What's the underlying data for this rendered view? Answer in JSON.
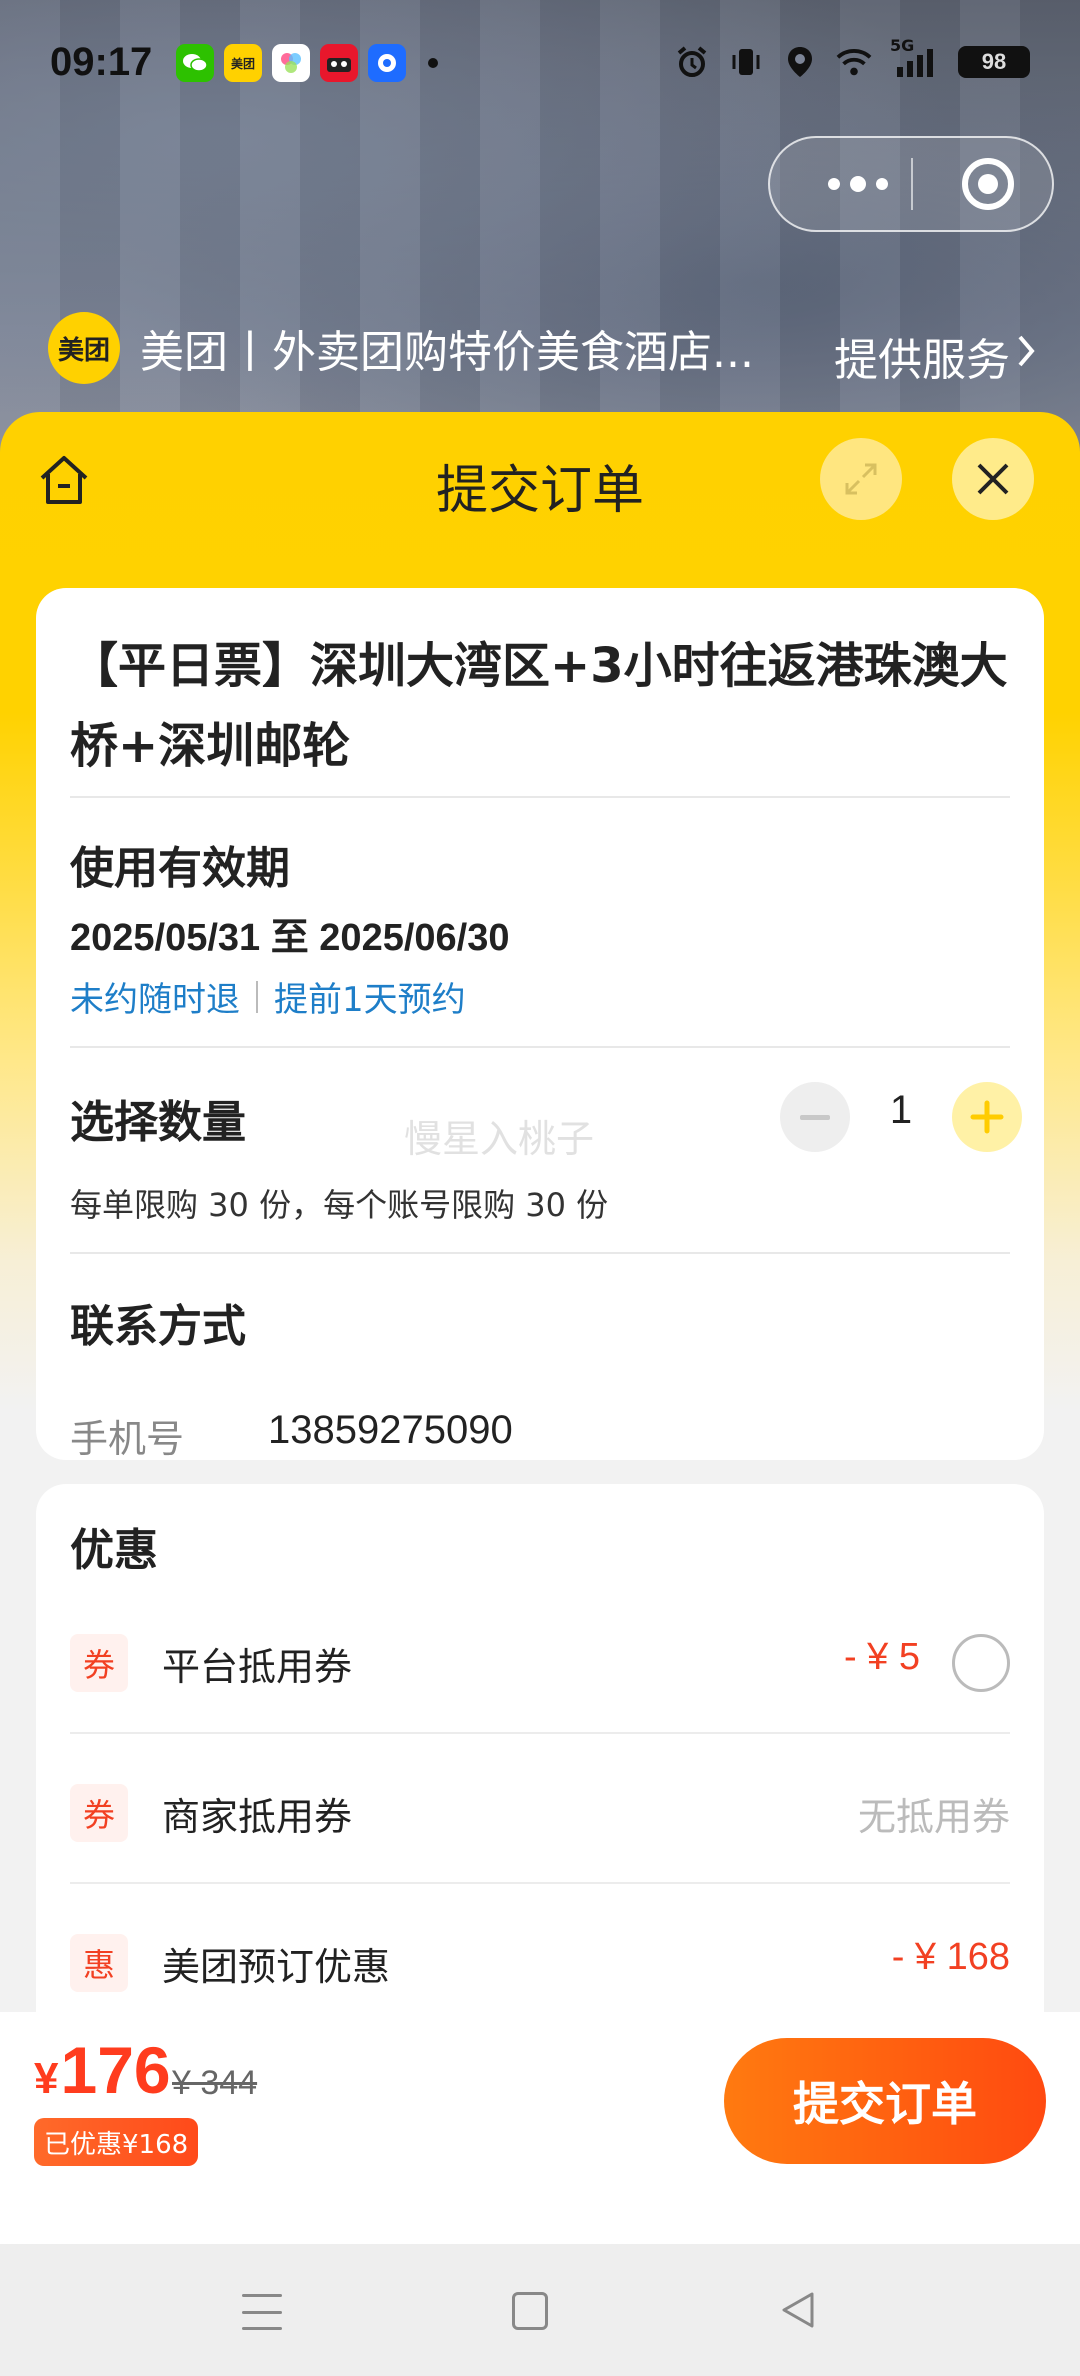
{
  "status_bar": {
    "time": "09:17",
    "battery": "98",
    "network": "5G",
    "app_icons": [
      "wechat-icon",
      "meituan-app-icon",
      "photos-app-icon",
      "tmall-app-icon",
      "browser-app-icon"
    ],
    "right_icons": [
      "alarm-icon",
      "vibrate-icon",
      "location-icon",
      "wifi-icon",
      "signal-icon",
      "battery-icon"
    ]
  },
  "capsule": {
    "more": "more-icon",
    "close": "target-icon"
  },
  "mini_program": {
    "logo_text": "美团",
    "name": "美团丨外卖团购特价美食酒店...",
    "service": "提供服务"
  },
  "sheet": {
    "title": "提交订单"
  },
  "order": {
    "product_title": "【平日票】深圳大湾区+3小时往返港珠澳大桥+深圳邮轮",
    "validity": {
      "title": "使用有效期",
      "dates": "2025/05/31 至 2025/06/30",
      "tag_1": "未约随时退",
      "tag_2": "提前1天预约"
    },
    "quantity": {
      "title": "选择数量",
      "value": "1",
      "limit": "每单限购 30 份，每个账号限购 30 份"
    },
    "watermark": "慢星入桃子",
    "contact": {
      "title": "联系方式",
      "label": "手机号",
      "value": "13859275090"
    }
  },
  "discounts": {
    "title": "优惠",
    "items": [
      {
        "badge": "券",
        "label": "平台抵用券",
        "value": "- ¥ 5",
        "selected": false
      },
      {
        "badge": "券",
        "label": "商家抵用券",
        "value": "无抵用券"
      },
      {
        "badge": "惠",
        "label": "美团预订优惠",
        "value": "- ¥ 168"
      }
    ]
  },
  "footer": {
    "currency": "¥",
    "price": "176",
    "original_price": "¥ 344",
    "saved": "已优惠¥168",
    "submit_label": "提交订单"
  },
  "colors": {
    "brand_yellow": "#ffd100",
    "accent_red": "#f24022",
    "link_blue": "#1e7ec8",
    "submit_orange": "#ff5a10"
  }
}
